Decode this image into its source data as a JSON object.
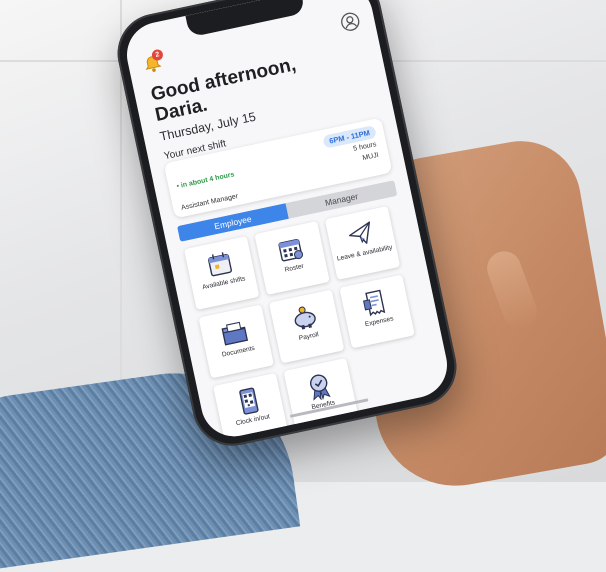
{
  "header": {
    "notification_count": "2"
  },
  "greeting": "Good afternoon, Daria.",
  "date": "Thursday, July 15",
  "next_shift": {
    "heading": "Your next shift",
    "time": "6PM - 11PM",
    "eta": "• in about 4 hours",
    "duration": "5 hours",
    "location": "MUJI",
    "role": "Assistant Manager"
  },
  "tabs": [
    {
      "label": "Employee",
      "active": true
    },
    {
      "label": "Manager",
      "active": false
    }
  ],
  "tiles": [
    {
      "label": "Available shifts",
      "icon": "calendar-shifts-icon"
    },
    {
      "label": "Roster",
      "icon": "roster-calendar-icon"
    },
    {
      "label": "Leave & availability",
      "icon": "paper-plane-icon"
    },
    {
      "label": "Documents",
      "icon": "folder-icon"
    },
    {
      "label": "Payroll",
      "icon": "piggy-bank-icon"
    },
    {
      "label": "Expenses",
      "icon": "receipt-icon"
    },
    {
      "label": "Clock in/out",
      "icon": "phone-qr-icon"
    },
    {
      "label": "Benefits",
      "icon": "award-badge-icon"
    }
  ],
  "colors": {
    "accent": "#3d85e8",
    "eta_green": "#2f9a4a",
    "badge_red": "#e2453c",
    "pill_bg": "#dbe8fb"
  }
}
